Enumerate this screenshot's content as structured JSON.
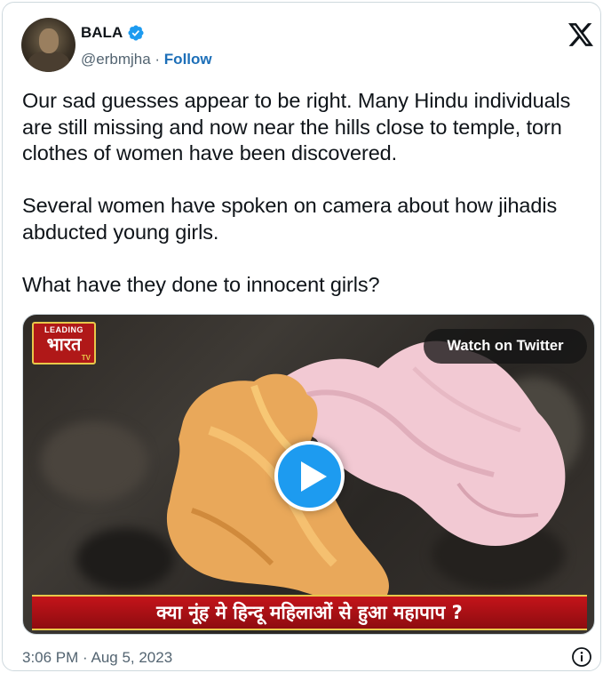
{
  "author": {
    "display_name": "BALA",
    "handle": "@erbmjha",
    "separator": " · ",
    "follow_label": "Follow",
    "verified_icon": "verified-badge-icon"
  },
  "tweet": {
    "paragraphs": [
      "Our sad guesses appear to be right. Many Hindu individuals are still missing and now near the hills close to temple, torn clothes of women have been discovered.",
      "Several women have spoken on camera about how jihadis abducted young girls.",
      "What have they done to innocent girls?"
    ]
  },
  "media": {
    "watch_label": "Watch on Twitter",
    "channel_logo": {
      "top": "LEADING",
      "main": "भारत",
      "suffix": "TV"
    },
    "caption": "क्या नूंह मे हिन्दू महिलाओं से हुआ महापाप ?",
    "play_icon": "play-icon"
  },
  "footer": {
    "timestamp": "3:06 PM · Aug 5, 2023",
    "info_icon": "info-icon"
  },
  "colors": {
    "accent": "#1d9bf0",
    "text": "#0f1419",
    "muted": "#536471",
    "follow": "#1d6fb8",
    "caption_bg": "#c4141a"
  }
}
